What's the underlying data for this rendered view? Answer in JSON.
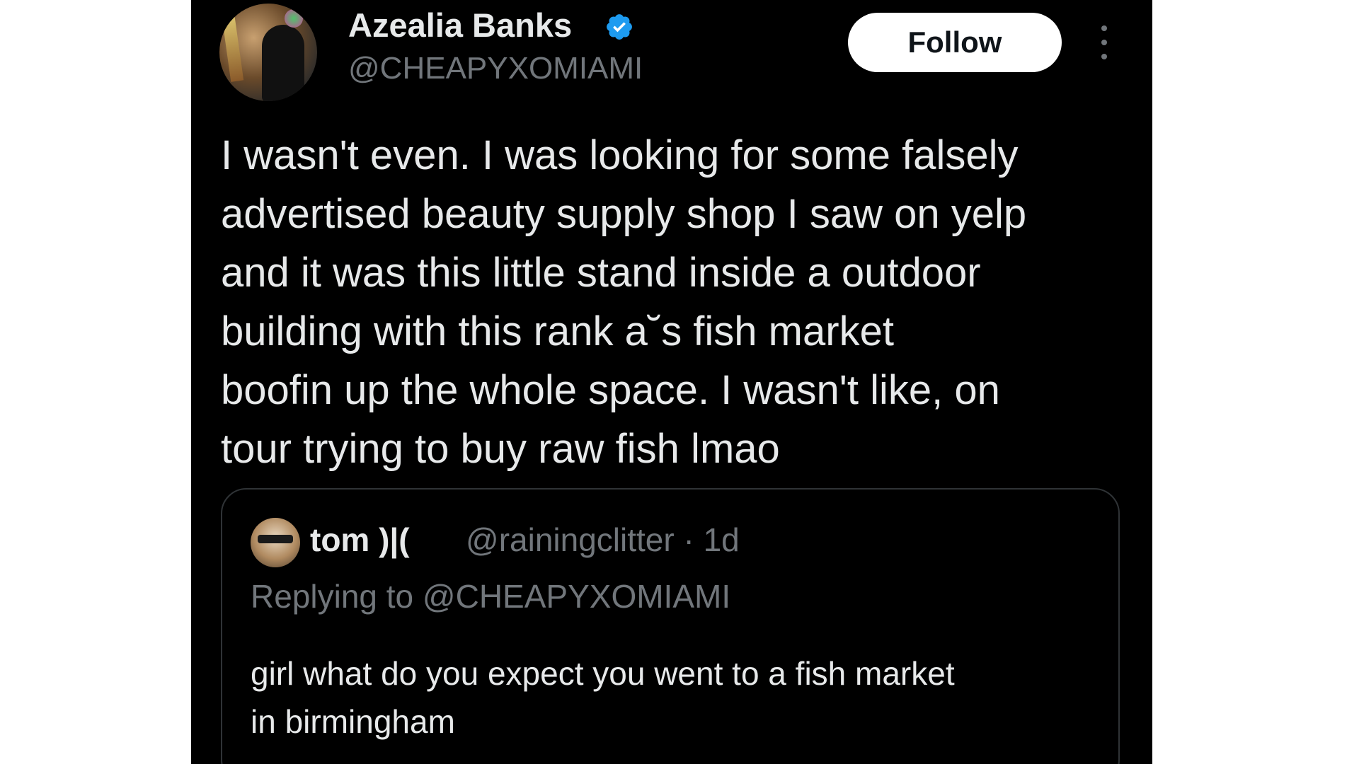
{
  "tweet": {
    "author": {
      "display_name": "Azealia Banks",
      "handle": "@CHEAPYXOMIAMI",
      "verified_icon": "verified-badge-icon",
      "avatar_icon": "avatar"
    },
    "follow_label": "Follow",
    "more_icon": "more-vertical-icon",
    "text_lines": [
      "I wasn't even. I was looking for some falsely",
      "advertised beauty supply shop I saw on yelp",
      "and it was this little stand inside a outdoor",
      "building with this rank a˘s fish market",
      "boofin up the whole space. I wasn't like, on",
      "tour trying to buy raw fish lmao"
    ]
  },
  "quote": {
    "author_name": "tom )|(",
    "handle_time": "@rainingclitter · 1d",
    "replying_to": "Replying to @CHEAPYXOMIAMI",
    "text_lines": [
      "girl what do you expect you went to a fish market",
      "in birmingham"
    ]
  },
  "colors": {
    "background": "#000000",
    "text_primary": "#e7e9ea",
    "text_secondary": "#71767b",
    "verified_blue": "#1d9bf0",
    "follow_bg": "#ffffff"
  }
}
